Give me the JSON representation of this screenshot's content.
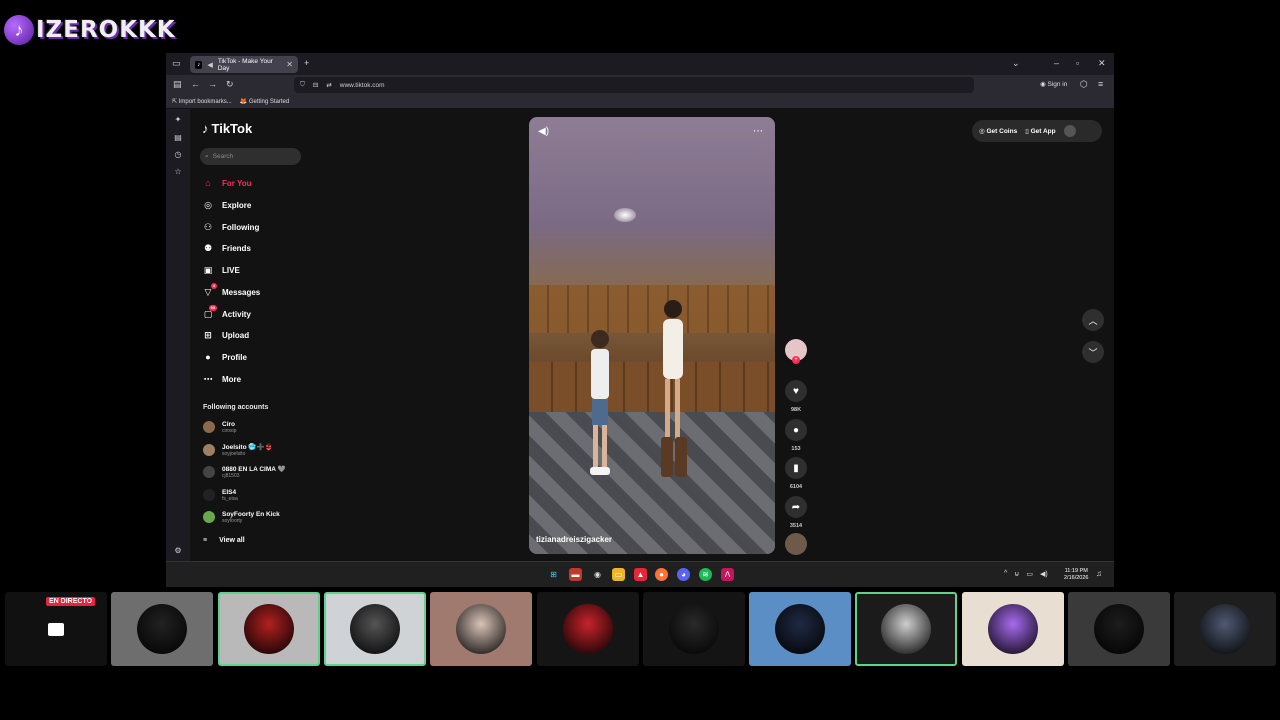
{
  "streamer_logo": {
    "text": "IZEROKKK",
    "mark": "♪"
  },
  "browser": {
    "tab_title": "TikTok - Make Your Day",
    "url": "www.tiktok.com",
    "sign_in": "Sign in",
    "bookmarks": [
      "Import bookmarks...",
      "Getting Started"
    ]
  },
  "tiktok": {
    "brand": "TikTok",
    "search_placeholder": "Search",
    "nav": [
      {
        "label": "For You",
        "icon": "home-icon",
        "glyph": "⌂",
        "active": true
      },
      {
        "label": "Explore",
        "icon": "compass-icon",
        "glyph": "◎"
      },
      {
        "label": "Following",
        "icon": "following-icon",
        "glyph": "⚇"
      },
      {
        "label": "Friends",
        "icon": "friends-icon",
        "glyph": "⚉"
      },
      {
        "label": "LIVE",
        "icon": "live-icon",
        "glyph": "▣"
      },
      {
        "label": "Messages",
        "icon": "messages-icon",
        "glyph": "▽",
        "badge": "4"
      },
      {
        "label": "Activity",
        "icon": "activity-icon",
        "glyph": "▢",
        "badge": "99"
      },
      {
        "label": "Upload",
        "icon": "upload-icon",
        "glyph": "⊞"
      },
      {
        "label": "Profile",
        "icon": "profile-icon",
        "glyph": "●"
      },
      {
        "label": "More",
        "icon": "more-icon",
        "glyph": "⋯"
      }
    ],
    "following_title": "Following accounts",
    "accounts": [
      {
        "name": "Ciro",
        "handle": "cirosip",
        "color": "#8a6a4a"
      },
      {
        "name": "Joelsito 🥶➕👙",
        "handle": "soyjoelsito",
        "color": "#a08060"
      },
      {
        "name": "0880 EN LA CIMA 🩶",
        "handle": "cj81503",
        "color": "#444"
      },
      {
        "name": "EIS4",
        "handle": "fs_eisa",
        "color": "#222"
      },
      {
        "name": "SoyFoorty En Kick",
        "handle": "soyfoorty",
        "color": "#6aa84f"
      }
    ],
    "view_all": "View all",
    "video": {
      "username": "tizianadreiszigacker"
    },
    "actions": {
      "likes": "98K",
      "comments": "153",
      "saves": "6104",
      "shares": "3514"
    },
    "get_coins": "Get Coins",
    "get_app": "Get App"
  },
  "taskbar": {
    "time": "11:19 PM",
    "date": "2/16/2026"
  },
  "participants": {
    "live_label": "EN DIRECTO",
    "tiles": [
      {
        "bg": "#111",
        "pic": "#ffffff",
        "screen": true
      },
      {
        "bg": "#6e6e6e",
        "pic": "#222",
        "selected": false
      },
      {
        "bg": "#b9b9b9",
        "pic": "#b32020",
        "selected": true
      },
      {
        "bg": "#cfd3d6",
        "pic": "#555",
        "selected": true
      },
      {
        "bg": "#a07a6e",
        "pic": "#d9c3b8",
        "selected": false
      },
      {
        "bg": "#151515",
        "pic": "#c9232b",
        "selected": false
      },
      {
        "bg": "#141414",
        "pic": "#2a2a2a",
        "selected": false
      },
      {
        "bg": "#5b8ec4",
        "pic": "#1f2a44",
        "selected": false
      },
      {
        "bg": "#1b1b1b",
        "pic": "#cfcfcf",
        "selected": true
      },
      {
        "bg": "#e8ded2",
        "pic": "#a86bf0",
        "selected": false
      },
      {
        "bg": "#3a3a3a",
        "pic": "#1d1d1d",
        "selected": false
      },
      {
        "bg": "#1e1e1e",
        "pic": "#4f5a72",
        "selected": false
      }
    ]
  }
}
